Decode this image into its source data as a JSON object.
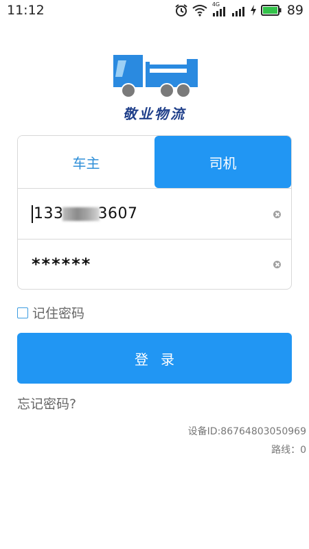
{
  "status_bar": {
    "time": "11:12",
    "network_label": "4G",
    "battery_percent": "89",
    "icons": [
      "alarm-icon",
      "wifi-icon",
      "signal-4g-icon",
      "signal-icon",
      "charging-icon",
      "battery-icon"
    ]
  },
  "logo": {
    "text": "敬业物流",
    "colors": {
      "truck_blue": "#2a8ae0",
      "text_navy": "#1f3f8a"
    }
  },
  "tabs": [
    {
      "label": "车主",
      "selected": false
    },
    {
      "label": "司机",
      "selected": true
    }
  ],
  "phone_field": {
    "value_prefix": "133",
    "value_suffix": "3607"
  },
  "password_field": {
    "value": "******"
  },
  "remember": {
    "label": "记住密码",
    "checked": false
  },
  "login_button": {
    "label": "登录"
  },
  "forgot_link": {
    "label": "忘记密码?"
  },
  "device_id": "设备ID:86764803050969",
  "route": "路线：0",
  "colors": {
    "accent": "#2196f3",
    "border": "#d8d8d8"
  }
}
